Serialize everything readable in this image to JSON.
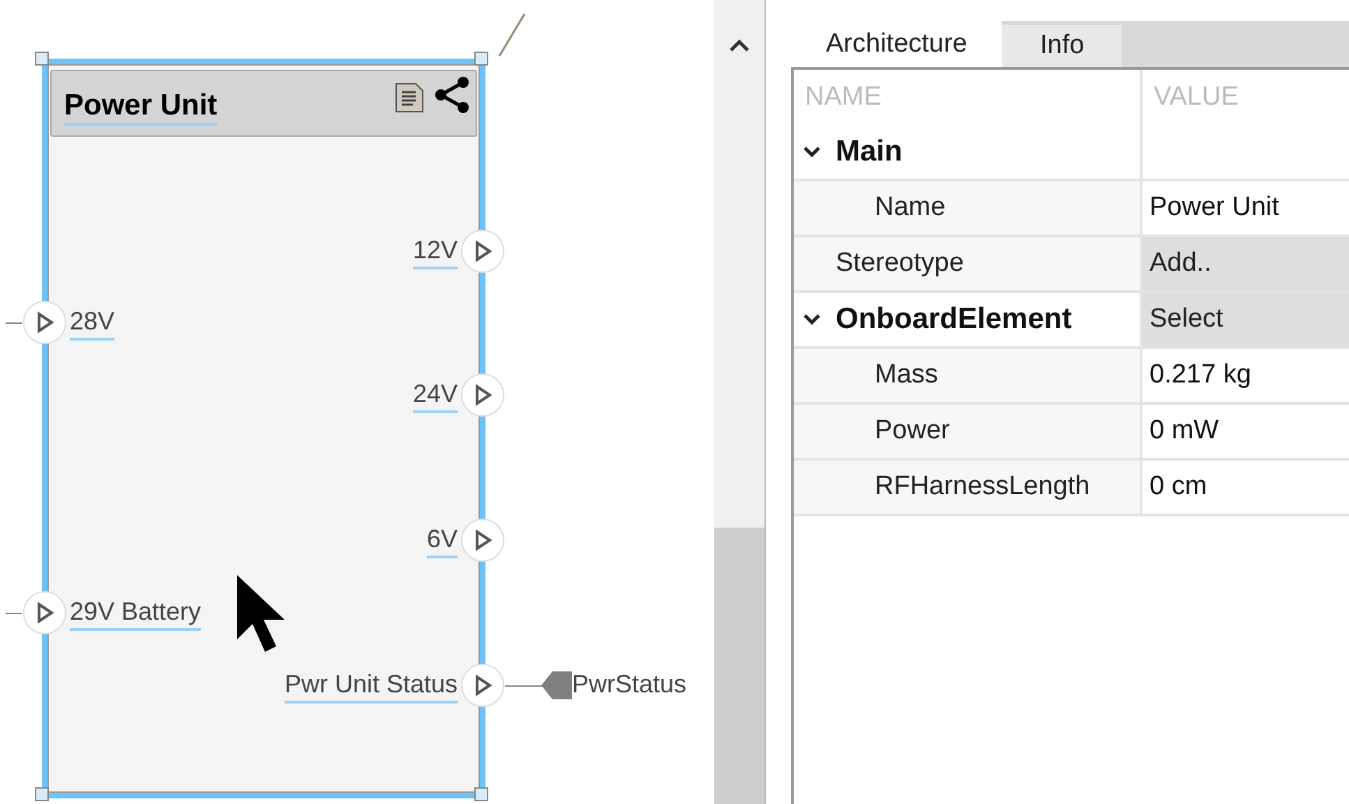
{
  "diagram": {
    "block": {
      "title": "Power Unit",
      "selected": true
    },
    "ports": [
      {
        "label": "12V",
        "kind": "output"
      },
      {
        "label": "28V",
        "kind": "input"
      },
      {
        "label": "24V",
        "kind": "output"
      },
      {
        "label": "6V",
        "kind": "output"
      },
      {
        "label": "29V Battery",
        "kind": "input"
      },
      {
        "label": "Pwr Unit Status",
        "kind": "output",
        "connected_to": "PwrStatus"
      }
    ]
  },
  "tabs": [
    {
      "label": "Architecture",
      "selected": true
    },
    {
      "label": "Info",
      "selected": false
    }
  ],
  "properties": {
    "columns": [
      "NAME",
      "VALUE"
    ],
    "rows": [
      {
        "kind": "group",
        "label": "Main",
        "expanded": true,
        "children": [
          {
            "kind": "property",
            "label": "Name",
            "value": "Power Unit"
          }
        ]
      },
      {
        "kind": "action",
        "label": "Stereotype",
        "value": "Add.."
      },
      {
        "kind": "group",
        "label": "OnboardElement",
        "expanded": true,
        "value": "Select",
        "children": [
          {
            "kind": "property",
            "label": "Mass",
            "value": "0.217 kg"
          },
          {
            "kind": "property",
            "label": "Power",
            "value": "0 mW"
          },
          {
            "kind": "property",
            "label": "RFHarnessLength",
            "value": "0 cm"
          }
        ]
      }
    ]
  }
}
